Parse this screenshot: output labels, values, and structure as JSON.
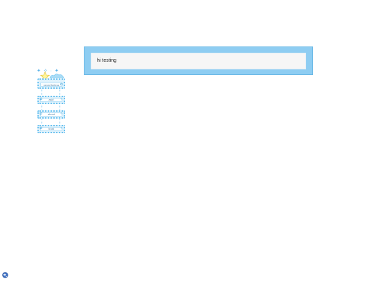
{
  "post": {
    "text": "hi testing"
  },
  "nav": {
    "header_deco": "✦ ✧ · ✦",
    "items": [
      {
        "label": "~ nevertheless ~",
        "icon": "star-icon"
      },
      {
        "label": "ask!",
        "icon": "paw-icon"
      },
      {
        "label": "about",
        "icon": "paw-icon"
      },
      {
        "label": "trust",
        "icon": "paw-icon"
      }
    ]
  },
  "icons": {
    "corner": "globe-icon",
    "header": "star-icon"
  },
  "colors": {
    "box_bg": "#8ecdf2",
    "inner_bg": "#f6f6f6",
    "nav_border": "#6fc3f0",
    "nav_fill": "#dff2fc"
  }
}
